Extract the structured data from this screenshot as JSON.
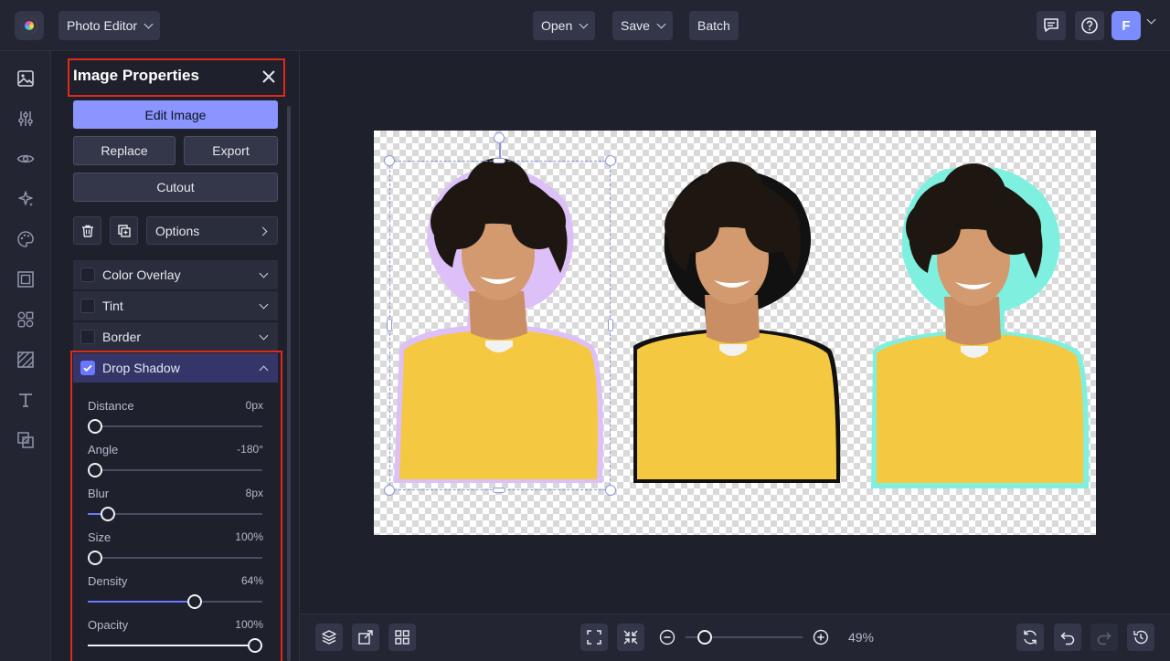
{
  "topbar": {
    "app_menu_label": "Photo Editor",
    "open_label": "Open",
    "save_label": "Save",
    "batch_label": "Batch",
    "avatar_letter": "F"
  },
  "panel": {
    "title": "Image Properties",
    "edit_image_label": "Edit Image",
    "replace_label": "Replace",
    "export_label": "Export",
    "cutout_label": "Cutout",
    "options_label": "Options",
    "effects": [
      {
        "label": "Color Overlay",
        "checked": false,
        "expanded": false
      },
      {
        "label": "Tint",
        "checked": false,
        "expanded": false
      },
      {
        "label": "Border",
        "checked": false,
        "expanded": false
      },
      {
        "label": "Drop Shadow",
        "checked": true,
        "expanded": true
      }
    ],
    "drop_shadow": {
      "distance": {
        "label": "Distance",
        "value_text": "0px",
        "fraction": 0.0
      },
      "angle": {
        "label": "Angle",
        "value_text": "-180°",
        "fraction": 0.0
      },
      "blur": {
        "label": "Blur",
        "value_text": "8px",
        "fraction": 0.08
      },
      "size": {
        "label": "Size",
        "value_text": "100%",
        "fraction": 0.0
      },
      "density": {
        "label": "Density",
        "value_text": "64%",
        "fraction": 0.62
      },
      "opacity": {
        "label": "Opacity",
        "value_text": "100%",
        "fraction": 1.0
      }
    }
  },
  "bottombar": {
    "zoom_value": "49%",
    "zoom_fraction": 0.12
  },
  "colors": {
    "accent": "#8a95ff",
    "highlight": "#e0291b",
    "outline_purple": "#d8b8f5",
    "outline_black": "#111111",
    "outline_cyan": "#7ff0e0",
    "sweater_yellow": "#f5c842"
  }
}
